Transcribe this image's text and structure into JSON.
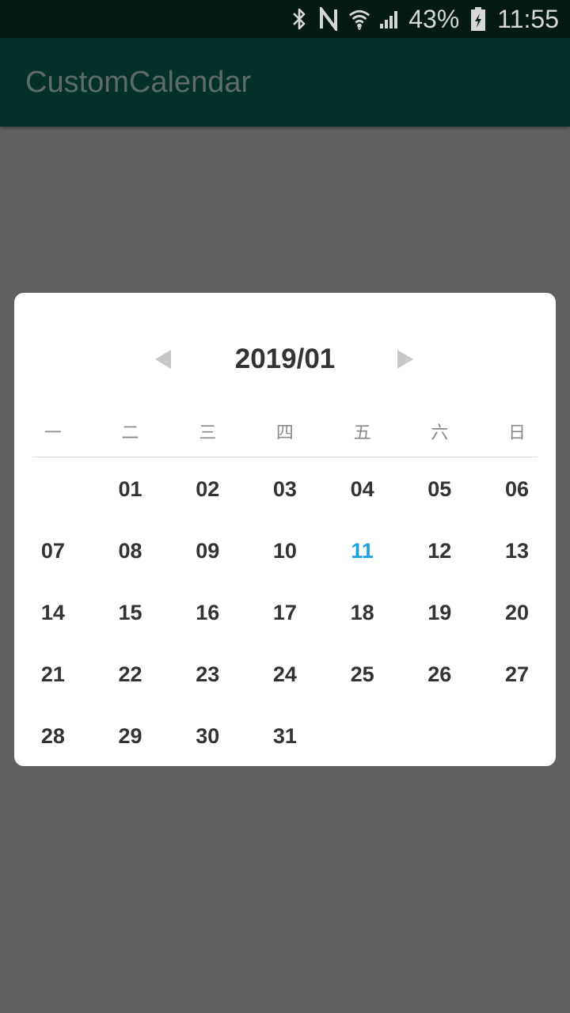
{
  "status_bar": {
    "battery_text": "43%",
    "time": "11:55",
    "icons": [
      "bluetooth-icon",
      "nfc-icon",
      "wifi-icon",
      "signal-icon",
      "battery-icon"
    ]
  },
  "app_bar": {
    "title": "CustomCalendar"
  },
  "calendar": {
    "month_title": "2019/01",
    "weekdays": [
      "一",
      "二",
      "三",
      "四",
      "五",
      "六",
      "日"
    ],
    "selected_day": "11",
    "accent_color": "#1aa0e6",
    "weeks": [
      [
        "",
        "01",
        "02",
        "03",
        "04",
        "05",
        "06"
      ],
      [
        "07",
        "08",
        "09",
        "10",
        "11",
        "12",
        "13"
      ],
      [
        "14",
        "15",
        "16",
        "17",
        "18",
        "19",
        "20"
      ],
      [
        "21",
        "22",
        "23",
        "24",
        "25",
        "26",
        "27"
      ],
      [
        "28",
        "29",
        "30",
        "31",
        "",
        "",
        ""
      ]
    ]
  }
}
